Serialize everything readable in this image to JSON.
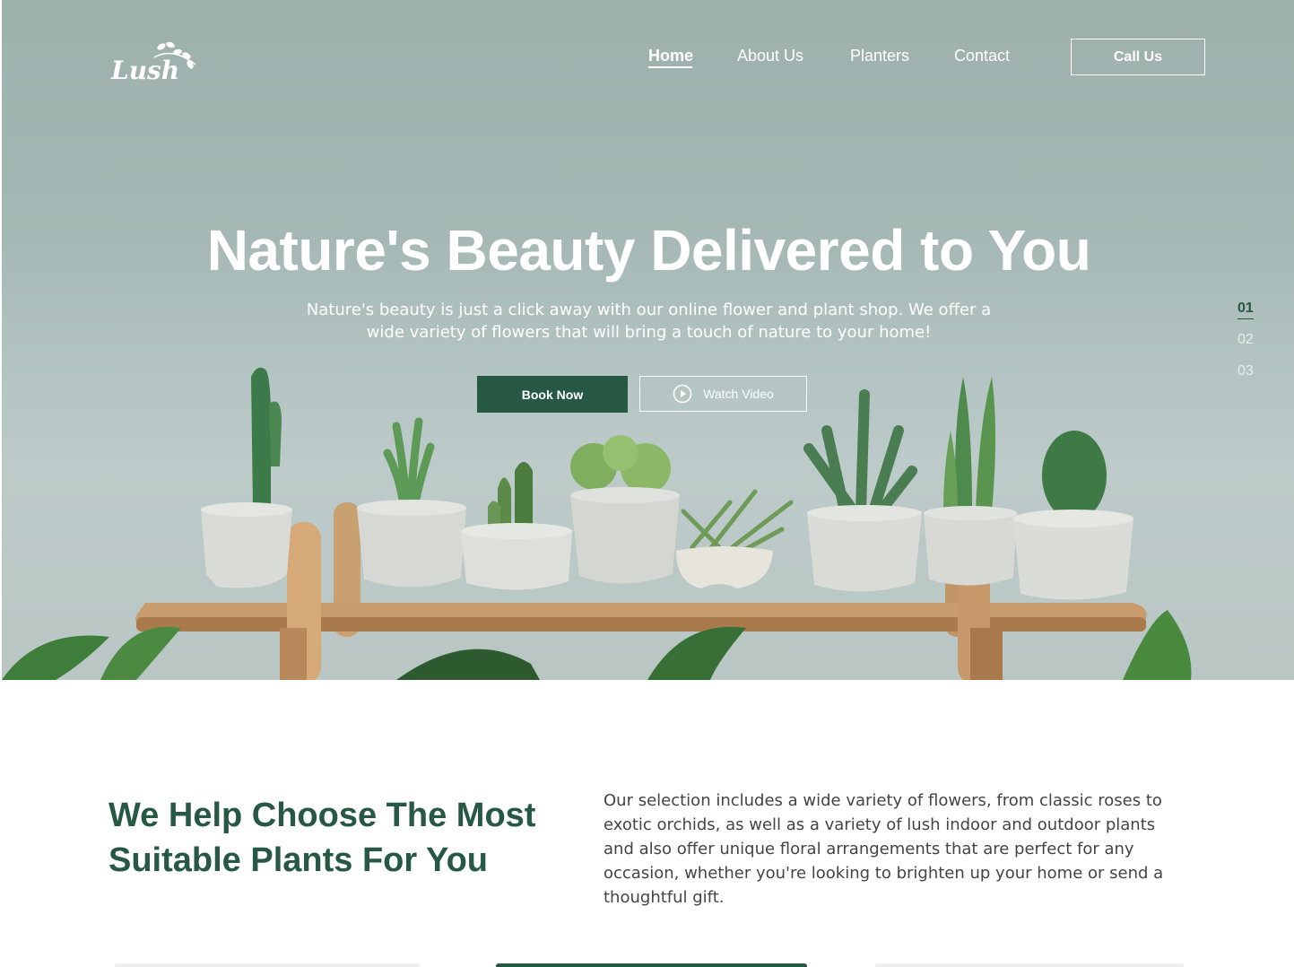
{
  "brand": {
    "logo_text": "Lush"
  },
  "nav": {
    "items": [
      {
        "label": "Home",
        "active": true
      },
      {
        "label": "About Us",
        "active": false
      },
      {
        "label": "Planters",
        "active": false
      },
      {
        "label": "Contact",
        "active": false
      }
    ],
    "call_label": "Call Us"
  },
  "hero": {
    "title": "Nature's Beauty Delivered to You",
    "subtitle": "Nature's beauty is just a click away with our online flower and plant shop. We offer a wide variety of flowers that will bring a touch of nature to your home!",
    "book_label": "Book Now",
    "video_label": "Watch Video",
    "slides": [
      "01",
      "02",
      "03"
    ],
    "active_slide": "01"
  },
  "section": {
    "heading": "We Help Choose The Most Suitable Plants For You",
    "text": "Our selection includes a wide variety of flowers, from classic roses to exotic orchids, as well as a variety of lush indoor and outdoor plants and also offer unique floral arrangements that are perfect for any occasion, whether you're looking to brighten up your home or send a thoughtful gift."
  },
  "colors": {
    "brand_green": "#275843",
    "text_gray": "#444444",
    "hero_bg": "#a6b8b5"
  }
}
